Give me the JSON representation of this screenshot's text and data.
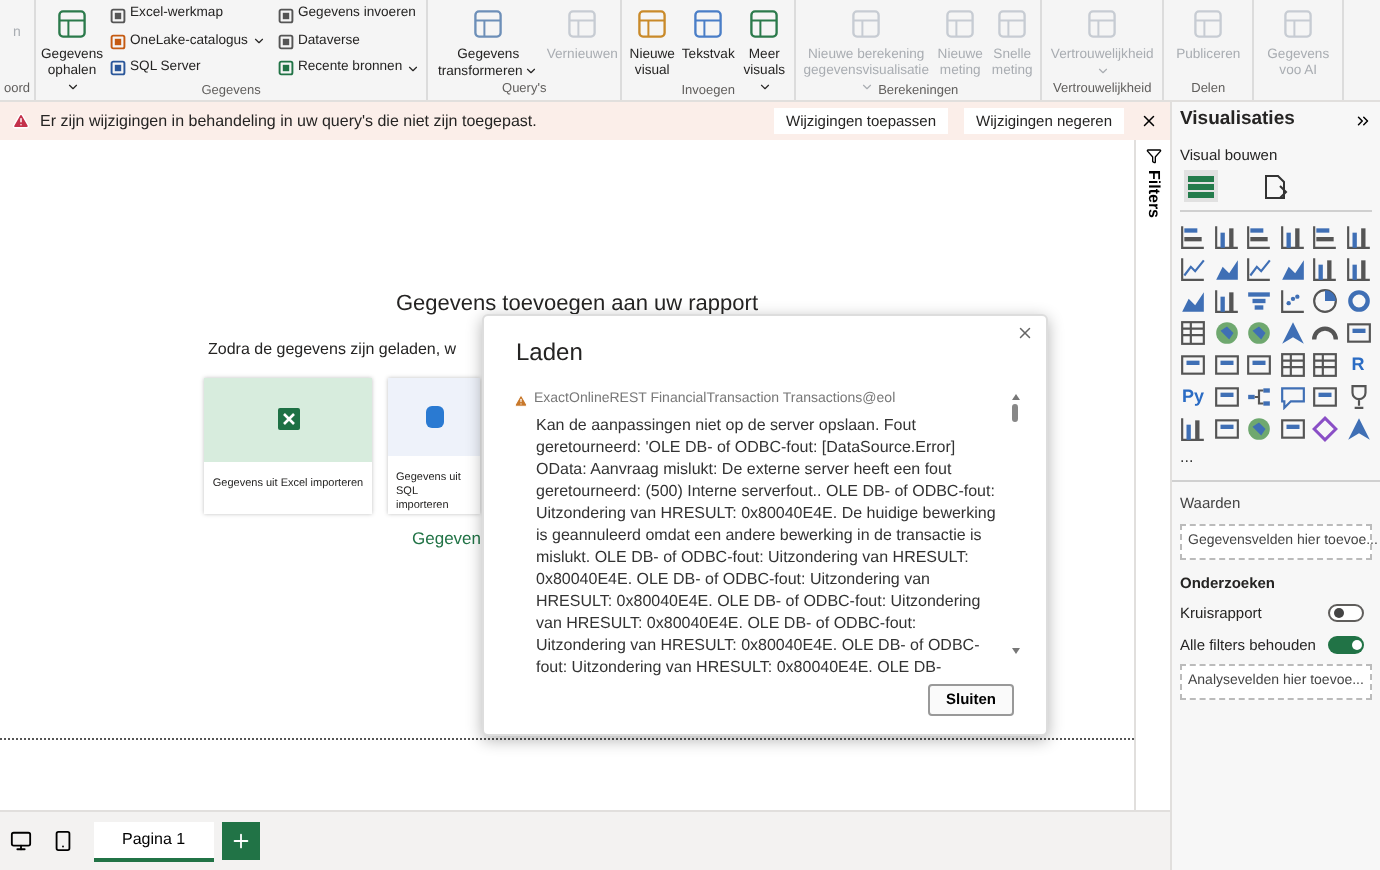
{
  "ribbon": {
    "groups": [
      {
        "label": "oord",
        "items": [
          {
            "label": "n",
            "kind": "clip",
            "disabled": true
          }
        ]
      },
      {
        "label": "Gegevens",
        "items": [
          {
            "label": "Gegevens ophalen",
            "kind": "large",
            "dropdown": true,
            "disabled": false
          },
          {
            "label": "Excel-werkmap",
            "kind": "small",
            "disabled": false
          },
          {
            "label": "OneLake-catalogus",
            "kind": "small",
            "dropdown": true,
            "disabled": false
          },
          {
            "label": "SQL Server",
            "kind": "small",
            "disabled": false
          },
          {
            "label": "Gegevens invoeren",
            "kind": "small",
            "disabled": false
          },
          {
            "label": "Dataverse",
            "kind": "small",
            "disabled": false
          },
          {
            "label": "Recente bronnen",
            "kind": "small",
            "dropdown": true,
            "disabled": false
          }
        ]
      },
      {
        "label": "Query's",
        "items": [
          {
            "label": "Gegevens transformeren",
            "kind": "large",
            "dropdown": true,
            "disabled": false
          },
          {
            "label": "Vernieuwen",
            "kind": "large",
            "disabled": true
          }
        ]
      },
      {
        "label": "Invoegen",
        "items": [
          {
            "label": "Nieuwe visual",
            "kind": "large",
            "disabled": false
          },
          {
            "label": "Tekstvak",
            "kind": "large",
            "disabled": false
          },
          {
            "label": "Meer visuals",
            "kind": "large",
            "dropdown": true,
            "disabled": false
          }
        ]
      },
      {
        "label": "Berekeningen",
        "items": [
          {
            "label": "Nieuwe berekening gegevensvisualisatie",
            "kind": "large",
            "dropdown": true,
            "disabled": true
          },
          {
            "label": "Nieuwe meting",
            "kind": "large",
            "disabled": true
          },
          {
            "label": "Snelle meting",
            "kind": "large",
            "disabled": true
          }
        ]
      },
      {
        "label": "Vertrouwelijkheid",
        "items": [
          {
            "label": "Vertrouwelijkheid",
            "kind": "large",
            "dropdown": true,
            "disabled": true
          }
        ]
      },
      {
        "label": "Delen",
        "items": [
          {
            "label": "Publiceren",
            "kind": "large",
            "disabled": true
          }
        ]
      },
      {
        "items": [
          {
            "label": "Gegevens voo AI",
            "kind": "large",
            "disabled": true
          }
        ]
      }
    ]
  },
  "warning_bar": {
    "message": "Er zijn wijzigingen in behandeling in uw query's die niet zijn toegepast.",
    "actions": [
      "Wijzigingen toepassen",
      "Wijzigingen negeren"
    ]
  },
  "canvas": {
    "title": "Gegevens toevoegen aan uw rapport",
    "subtitle": "Zodra de gegevens zijn geladen, w",
    "cards": [
      {
        "label": "Gegevens uit Excel importeren",
        "kind": "excel"
      },
      {
        "label": "Gegevens uit SQL importeren",
        "kind": "sql"
      }
    ],
    "link": "Gegeven"
  },
  "dialog": {
    "title": "Laden",
    "source": "ExactOnlineREST FinancialTransaction Transactions@eol",
    "message": "Kan de aanpassingen niet op de server opslaan. Fout geretourneerd: 'OLE DB- of ODBC-fout: [DataSource.Error] OData: Aanvraag mislukt: De externe server heeft een fout geretourneerd: (500) Interne serverfout.. OLE DB- of ODBC-fout: Uitzondering van HRESULT: 0x80040E4E. De huidige bewerking is geannuleerd omdat een andere bewerking in de transactie is mislukt. OLE DB- of ODBC-fout: Uitzondering van HRESULT: 0x80040E4E. OLE DB- of ODBC-fout: Uitzondering van HRESULT: 0x80040E4E. OLE DB- of ODBC-fout: Uitzondering van HRESULT: 0x80040E4E. OLE DB- of ODBC-fout: Uitzondering van HRESULT: 0x80040E4E. OLE DB- of ODBC-fout: Uitzondering van HRESULT: 0x80040E4E. OLE DB-",
    "button": "Sluiten"
  },
  "filters_pane": {
    "label": "Filters"
  },
  "visualizations": {
    "title": "Visualisaties",
    "build_label": "Visual bouwen",
    "modes": [
      {
        "kind": "build",
        "selected": true
      },
      {
        "kind": "format",
        "selected": false
      }
    ],
    "visuals": [
      {
        "kind": "bar"
      },
      {
        "kind": "column"
      },
      {
        "kind": "bar"
      },
      {
        "kind": "column"
      },
      {
        "kind": "bar"
      },
      {
        "kind": "column"
      },
      {
        "kind": "line"
      },
      {
        "kind": "area"
      },
      {
        "kind": "line"
      },
      {
        "kind": "area"
      },
      {
        "kind": "column"
      },
      {
        "kind": "column"
      },
      {
        "kind": "area"
      },
      {
        "kind": "column"
      },
      {
        "kind": "funnel"
      },
      {
        "kind": "scatter"
      },
      {
        "kind": "pie"
      },
      {
        "kind": "donut"
      },
      {
        "kind": "table"
      },
      {
        "kind": "map"
      },
      {
        "kind": "map"
      },
      {
        "kind": "arrow"
      },
      {
        "kind": "gauge"
      },
      {
        "kind": "card"
      },
      {
        "kind": "card"
      },
      {
        "kind": "card"
      },
      {
        "kind": "card"
      },
      {
        "kind": "table"
      },
      {
        "kind": "table"
      },
      {
        "kind": "text",
        "label": "R"
      },
      {
        "kind": "text",
        "label": "Py"
      },
      {
        "kind": "card"
      },
      {
        "kind": "tree"
      },
      {
        "kind": "chat"
      },
      {
        "kind": "card"
      },
      {
        "kind": "trophy"
      },
      {
        "kind": "column"
      },
      {
        "kind": "card"
      },
      {
        "kind": "map"
      },
      {
        "kind": "card"
      },
      {
        "kind": "diamond"
      },
      {
        "kind": "arrow"
      }
    ],
    "more": "...",
    "values_label": "Waarden",
    "values_field": "Gegevensvelden hier toevoe...",
    "drill_label": "Onderzoeken",
    "toggles": [
      {
        "label": "Kruisrapport",
        "on": false
      },
      {
        "label": "Alle filters behouden",
        "on": true
      }
    ],
    "drill_field": "Analysevelden hier toevoe..."
  },
  "pages": [
    {
      "label": "Pagina 1",
      "selected": true
    }
  ]
}
